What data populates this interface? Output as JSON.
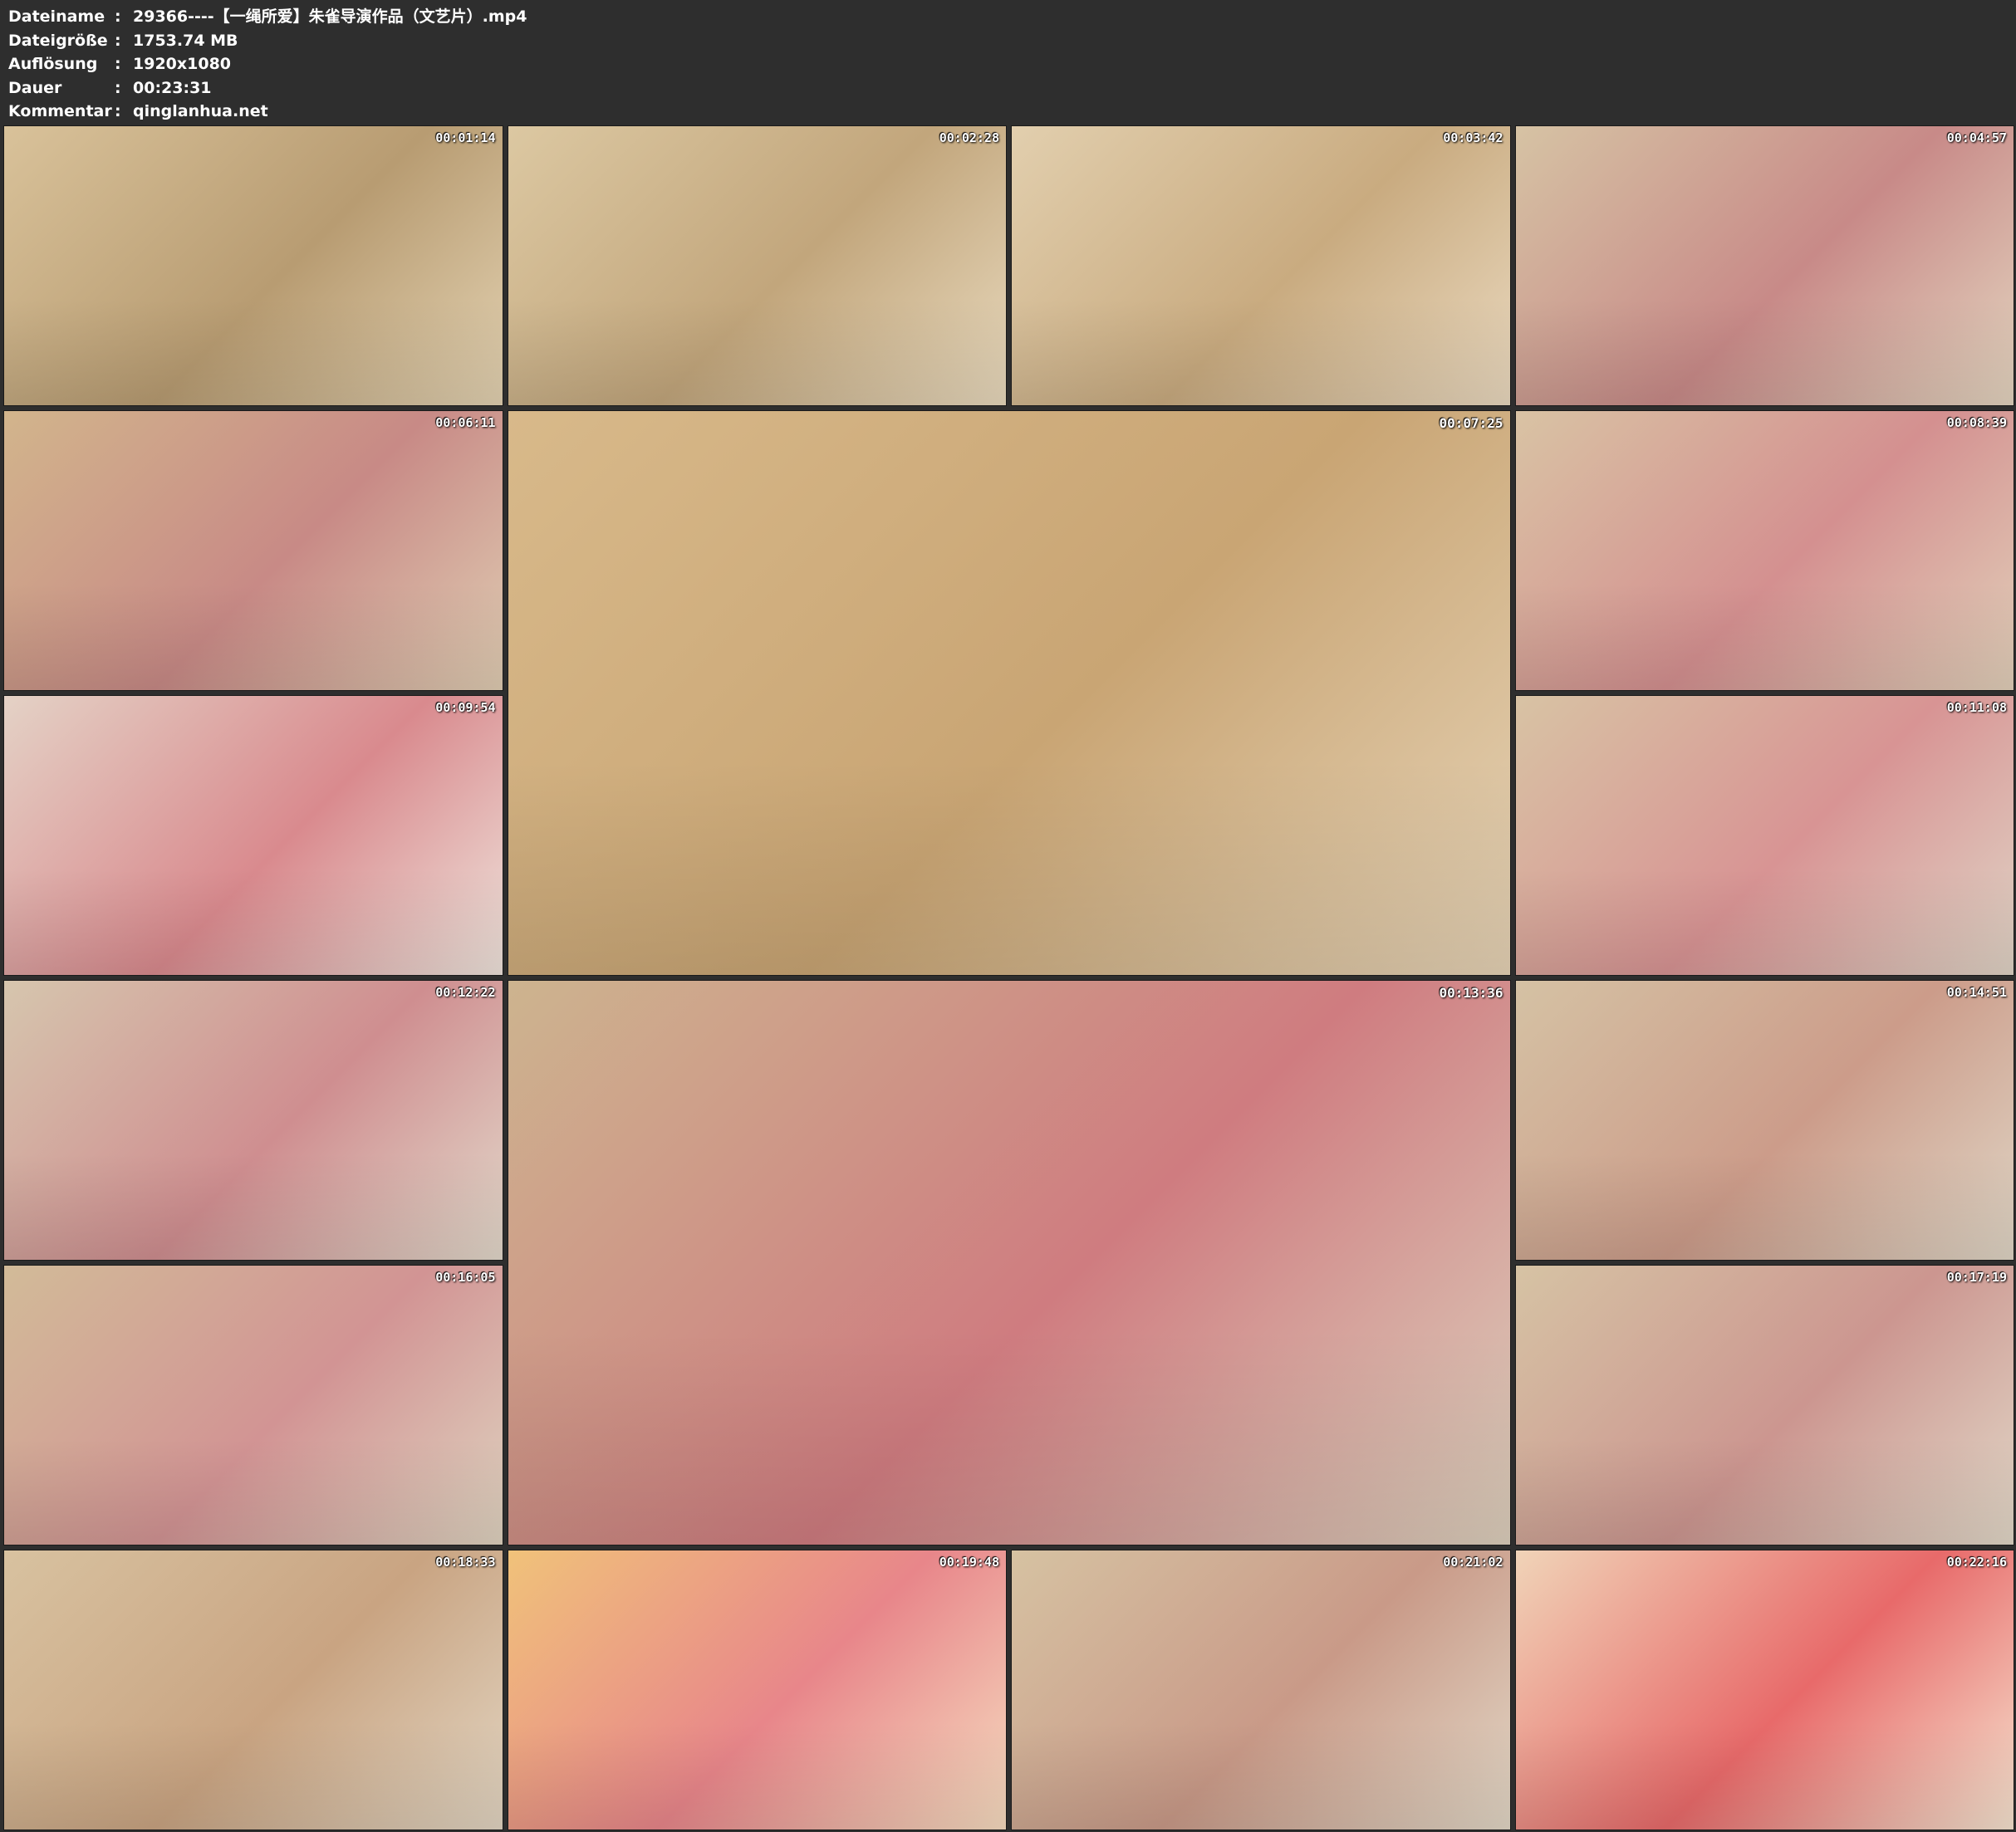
{
  "header": {
    "separator": ":",
    "rows": [
      {
        "label": "Dateiname",
        "value": "29366----【一绳所爱】朱雀导演作品（文艺片）.mp4"
      },
      {
        "label": "Dateigröße",
        "value": "1753.74 MB"
      },
      {
        "label": "Auflösung",
        "value": "1920x1080"
      },
      {
        "label": "Dauer",
        "value": "00:23:31"
      },
      {
        "label": "Kommentar",
        "value": "qinglanhua.net"
      }
    ]
  },
  "thumbnails": [
    {
      "timestamp": "00:01:14",
      "colors": [
        "#d9c29a",
        "#b89c72",
        "#e3d2b2"
      ]
    },
    {
      "timestamp": "00:02:28",
      "colors": [
        "#dcc8a2",
        "#c2a67c",
        "#e8d9bd"
      ]
    },
    {
      "timestamp": "00:03:42",
      "colors": [
        "#e2cfae",
        "#c9ab80",
        "#ead9bf"
      ]
    },
    {
      "timestamp": "00:04:57",
      "colors": [
        "#d6c3a4",
        "#c88a88",
        "#e4d5c0"
      ]
    },
    {
      "timestamp": "00:06:11",
      "colors": [
        "#d2b58c",
        "#c88a86",
        "#e0cdb3"
      ]
    },
    {
      "timestamp": "00:07:25",
      "colors": [
        "#d8b98a",
        "#c9a574",
        "#e6d3b6"
      ],
      "large": true
    },
    {
      "timestamp": "00:08:39",
      "colors": [
        "#d9c3a4",
        "#d49090",
        "#e2d0ba"
      ]
    },
    {
      "timestamp": "00:09:54",
      "colors": [
        "#e4d2c6",
        "#d98a8e",
        "#efe4dc"
      ]
    },
    {
      "timestamp": "00:11:08",
      "colors": [
        "#d8c3a4",
        "#d89494",
        "#e0d4c6"
      ]
    },
    {
      "timestamp": "00:12:22",
      "colors": [
        "#d6c6ae",
        "#cf8e90",
        "#e3d9cb"
      ]
    },
    {
      "timestamp": "00:13:36",
      "colors": [
        "#cdb48f",
        "#cf7c80",
        "#ddd0bd"
      ],
      "large": true
    },
    {
      "timestamp": "00:14:51",
      "colors": [
        "#d5c2a4",
        "#cc9c8a",
        "#e0d6c6"
      ]
    },
    {
      "timestamp": "00:16:05",
      "colors": [
        "#d2bb98",
        "#d29494",
        "#dfd3c0"
      ]
    },
    {
      "timestamp": "00:17:19",
      "colors": [
        "#d6c3a4",
        "#cc9690",
        "#e2d8c8"
      ]
    },
    {
      "timestamp": "00:18:33",
      "colors": [
        "#d8c2a0",
        "#c9a482",
        "#e2d5c2"
      ]
    },
    {
      "timestamp": "00:19:48",
      "colors": [
        "#f0c27a",
        "#e8868a",
        "#f6dcc0"
      ]
    },
    {
      "timestamp": "00:21:02",
      "colors": [
        "#d6c2a2",
        "#c99a88",
        "#e2d7c6"
      ]
    },
    {
      "timestamp": "00:22:16",
      "colors": [
        "#f0d4b8",
        "#e86a6a",
        "#f6e4d0"
      ]
    }
  ]
}
